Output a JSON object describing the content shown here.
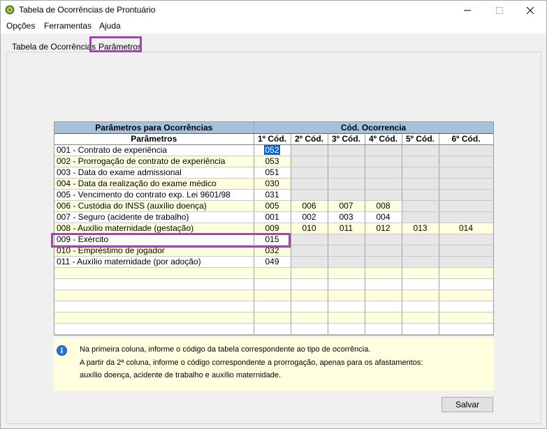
{
  "window": {
    "title": "Tabela de Ocorrências de Prontuário"
  },
  "menu": [
    "Opções",
    "Ferramentas",
    "Ajuda"
  ],
  "tabs": [
    "Tabela de Ocorrências",
    "Parâmetros"
  ],
  "grid": {
    "group_left": "Parâmetros para Ocorrências",
    "group_right": "Cód. Ocorrencia",
    "columns": [
      "Parâmetros",
      "1º Cód.",
      "2º Cód.",
      "3º Cód.",
      "4º Cód.",
      "5º Cód.",
      "6º Cód."
    ],
    "rows": [
      [
        "001 - Contrato de experiência",
        "052",
        "",
        "",
        "",
        "",
        ""
      ],
      [
        "002 - Prorrogação de contrato de experiência",
        "053",
        "",
        "",
        "",
        "",
        ""
      ],
      [
        "003 - Data do exame admissional",
        "051",
        "",
        "",
        "",
        "",
        ""
      ],
      [
        "004 - Data da realização do exame médico",
        "030",
        "",
        "",
        "",
        "",
        ""
      ],
      [
        "005 - Vencimento do contrato exp. Lei 9601/98",
        "031",
        "",
        "",
        "",
        "",
        ""
      ],
      [
        "006 - Custódia do INSS (auxílio doença)",
        "005",
        "006",
        "007",
        "008",
        "",
        ""
      ],
      [
        "007 - Seguro (acidente de trabalho)",
        "001",
        "002",
        "003",
        "004",
        "",
        ""
      ],
      [
        "008 - Auxílio maternidade (gestação)",
        "009",
        "010",
        "011",
        "012",
        "013",
        "014"
      ],
      [
        "009 - Exército",
        "015",
        "",
        "",
        "",
        "",
        ""
      ],
      [
        "010 - Empréstimo de jogador",
        "032",
        "",
        "",
        "",
        "",
        ""
      ],
      [
        "011 - Auxílio maternidade (por adoção)",
        "049",
        "",
        "",
        "",
        "",
        ""
      ]
    ]
  },
  "info": {
    "lines": [
      "Na primeira coluna, informe o código da tabela correspondente ao tipo de ocorrência.",
      "A partir da 2ª coluna, informe o código correspondente a prorrogação, apenas para os afastamentos:",
      "auxílio doença, acidente de trabalho e auxílio maternidade."
    ]
  },
  "buttons": {
    "save": "Salvar"
  },
  "colors": {
    "header": "#a7c0dc",
    "row_yellow": "#ffffdf",
    "highlight": "#9b4aa8",
    "selection": "#0a64c8"
  }
}
